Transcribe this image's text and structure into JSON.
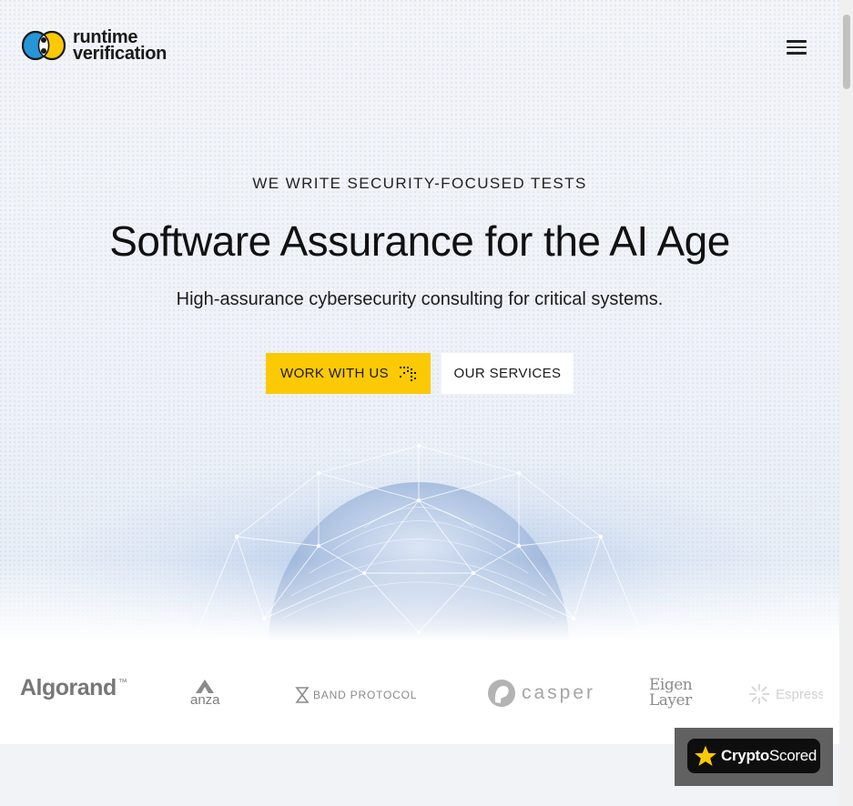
{
  "brand": {
    "name_line1": "runtime",
    "name_line2": "verification",
    "colors": {
      "blue": "#2596d8",
      "yellow": "#fcc905",
      "ink": "#1a1a1a"
    }
  },
  "header": {
    "menu_icon": "hamburger-menu-icon"
  },
  "hero": {
    "eyebrow": "WE WRITE SECURITY-FOCUSED TESTS",
    "title": "Software Assurance for the AI Age",
    "subtitle": "High-assurance cybersecurity consulting for critical systems.",
    "primary_button": {
      "label": "WORK WITH US",
      "icon": "sparkle-dots-icon",
      "color": "#fcc905"
    },
    "secondary_button": {
      "label": "OUR SERVICES"
    }
  },
  "partners": [
    {
      "name": "Algorand",
      "mark": "™"
    },
    {
      "name": "anza"
    },
    {
      "name": "BAND PROTOCOL"
    },
    {
      "name": "casper"
    },
    {
      "name_line1": "Eigen",
      "name_line2": "Layer"
    },
    {
      "name": "Espresso"
    }
  ],
  "badge": {
    "label_bold": "Crypto",
    "label_rest": "Scored",
    "icon": "star-icon"
  }
}
